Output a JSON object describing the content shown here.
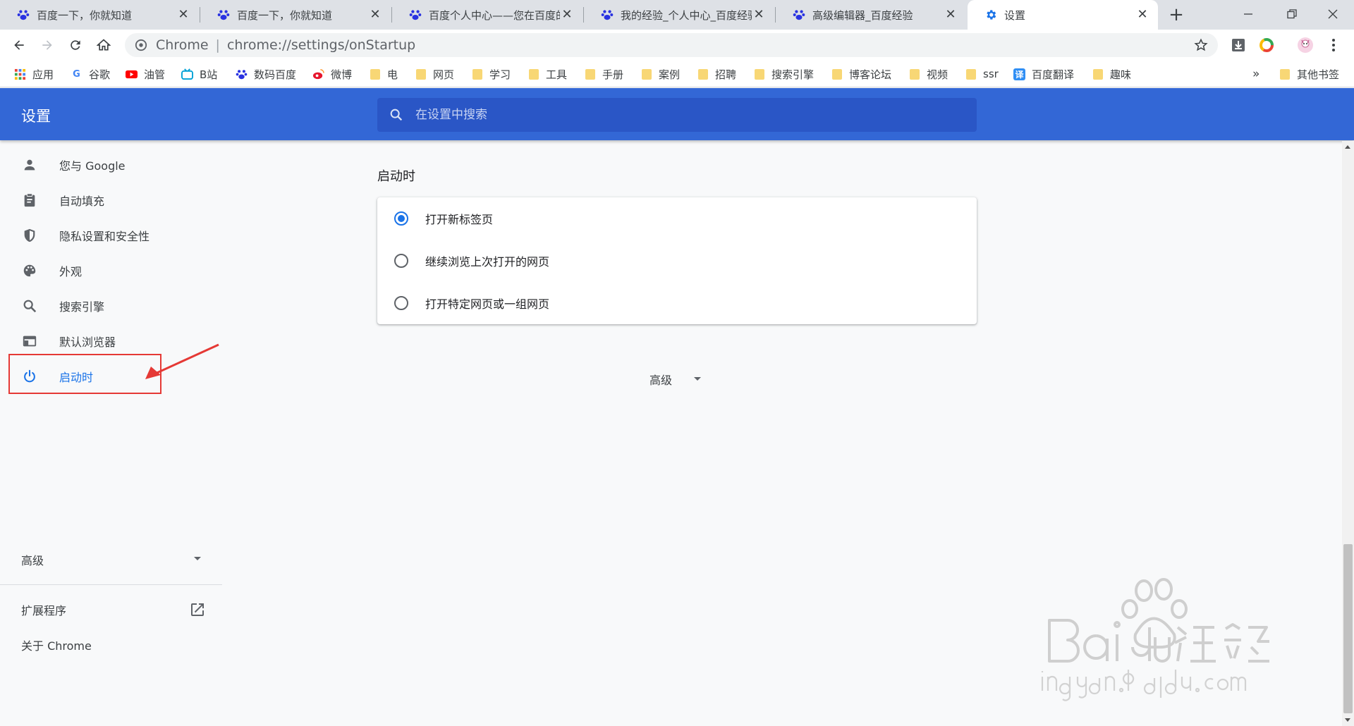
{
  "browser": {
    "tabs": [
      {
        "title": "百度一下，你就知道",
        "close": "✕"
      },
      {
        "title": "百度一下，你就知道",
        "close": "✕"
      },
      {
        "title": "百度个人中心——您在百度的",
        "close": "✕"
      },
      {
        "title": "我的经验_个人中心_百度经验",
        "close": "✕"
      },
      {
        "title": "高级编辑器_百度经验",
        "close": "✕"
      },
      {
        "title": "设置",
        "close": "✕"
      }
    ],
    "new_tab": "+",
    "omnibox": {
      "chip": "Chrome",
      "separator": "|",
      "url": "chrome://settings/onStartup"
    }
  },
  "bookmarks": [
    {
      "label": "应用",
      "icon": "apps-icon"
    },
    {
      "label": "谷歌",
      "icon": "google-icon"
    },
    {
      "label": "油管",
      "icon": "youtube-icon"
    },
    {
      "label": "B站",
      "icon": "bilibili-icon"
    },
    {
      "label": "数码百度",
      "icon": "baidu-icon"
    },
    {
      "label": "微博",
      "icon": "weibo-icon"
    },
    {
      "label": "电",
      "icon": "folder-icon"
    },
    {
      "label": "网页",
      "icon": "folder-icon"
    },
    {
      "label": "学习",
      "icon": "folder-icon"
    },
    {
      "label": "工具",
      "icon": "folder-icon"
    },
    {
      "label": "手册",
      "icon": "folder-icon"
    },
    {
      "label": "案例",
      "icon": "folder-icon"
    },
    {
      "label": "招聘",
      "icon": "folder-icon"
    },
    {
      "label": "搜索引擎",
      "icon": "folder-icon"
    },
    {
      "label": "博客论坛",
      "icon": "folder-icon"
    },
    {
      "label": "视频",
      "icon": "folder-icon"
    },
    {
      "label": "ssr",
      "icon": "folder-icon"
    },
    {
      "label": "百度翻译",
      "icon": "translate-icon"
    },
    {
      "label": "趣味",
      "icon": "folder-icon"
    }
  ],
  "bookmarks_overflow": "»",
  "other_bookmarks": "其他书签",
  "settings": {
    "title": "设置",
    "search_placeholder": "在设置中搜索",
    "nav": [
      {
        "label": "您与 Google",
        "icon": "person-icon"
      },
      {
        "label": "自动填充",
        "icon": "clipboard-icon"
      },
      {
        "label": "隐私设置和安全性",
        "icon": "shield-icon"
      },
      {
        "label": "外观",
        "icon": "palette-icon"
      },
      {
        "label": "搜索引擎",
        "icon": "search-icon"
      },
      {
        "label": "默认浏览器",
        "icon": "browser-icon"
      },
      {
        "label": "启动时",
        "icon": "power-icon"
      }
    ],
    "nav_advanced": "高级",
    "nav_extensions": "扩展程序",
    "nav_about": "关于 Chrome",
    "section_title": "启动时",
    "options": [
      {
        "label": "打开新标签页",
        "checked": true
      },
      {
        "label": "继续浏览上次打开的网页",
        "checked": false
      },
      {
        "label": "打开特定网页或一组网页",
        "checked": false
      }
    ],
    "advanced_toggle": "高级"
  },
  "colors": {
    "header": "#3367d6",
    "accent": "#1a73e8",
    "annotation": "#e53935"
  }
}
